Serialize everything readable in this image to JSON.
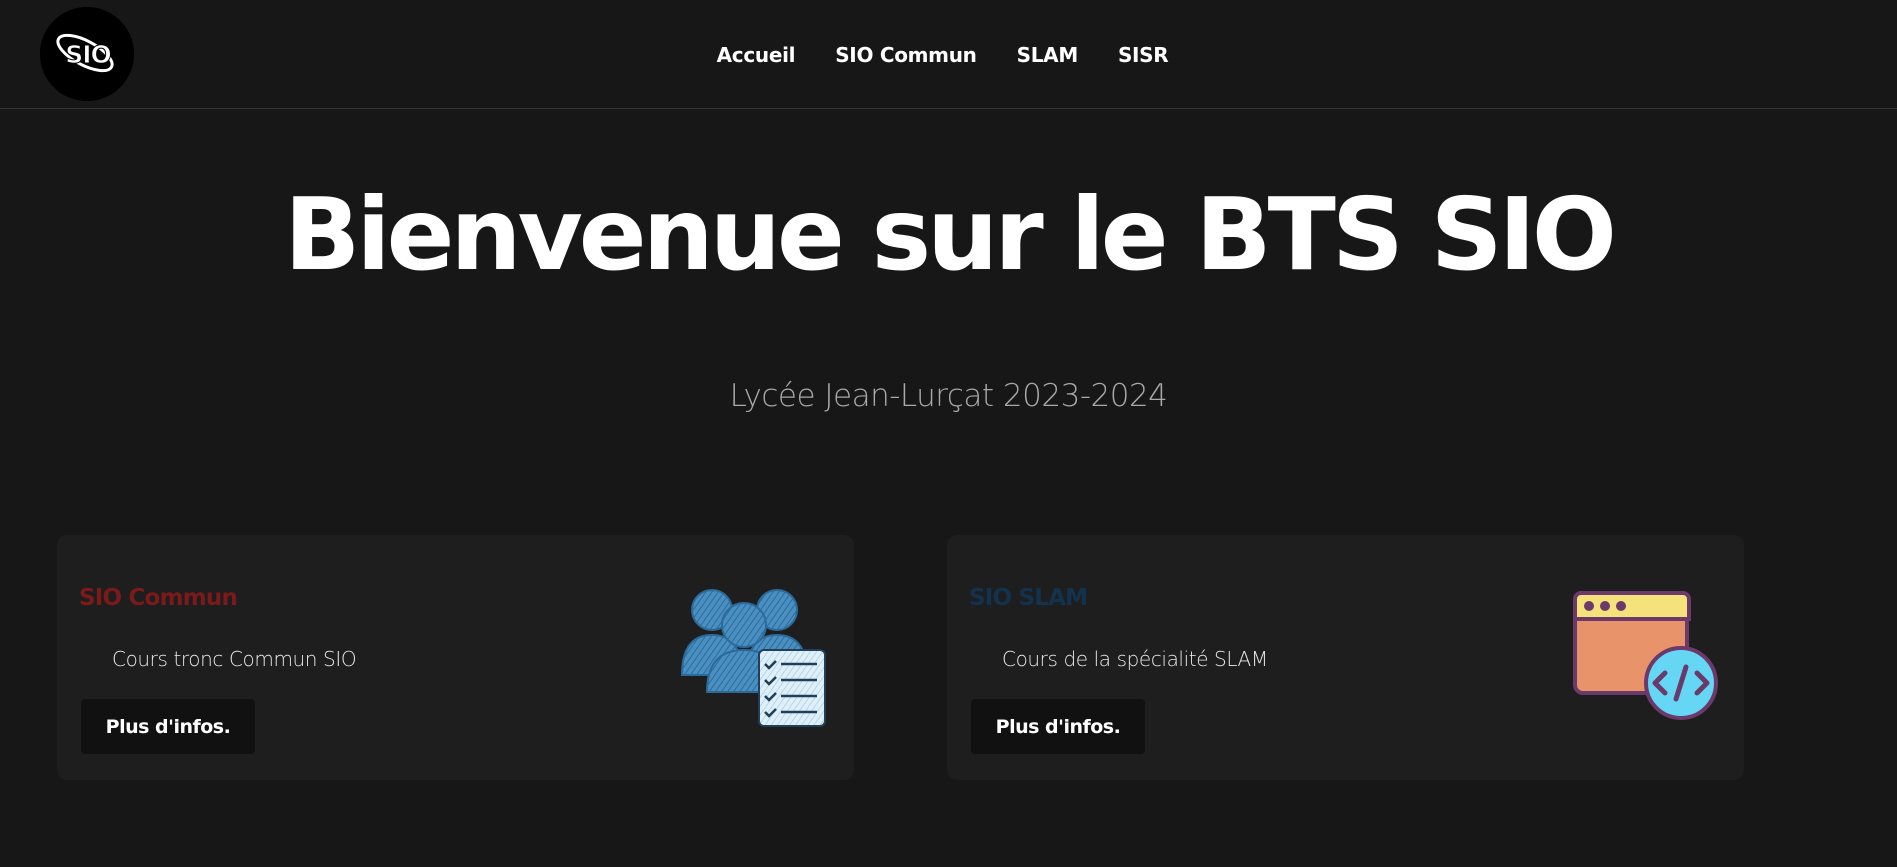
{
  "header": {
    "logo_text": "SIO",
    "nav": [
      {
        "label": "Accueil"
      },
      {
        "label": "SIO Commun"
      },
      {
        "label": "SLAM"
      },
      {
        "label": "SISR"
      }
    ]
  },
  "hero": {
    "title": "Bienvenue sur le BTS SIO",
    "subtitle": "Lycée Jean-Lurçat 2023-2024"
  },
  "cards": [
    {
      "title": "SIO Commun",
      "title_color": "#7a1a1a",
      "description": "Cours tronc Commun SIO",
      "button_label": "Plus d'infos.",
      "icon": "people-checklist-icon"
    },
    {
      "title": "SIO SLAM",
      "title_color": "#13324d",
      "description": "Cours de la spécialité SLAM",
      "button_label": "Plus d'infos.",
      "icon": "browser-code-icon"
    }
  ],
  "colors": {
    "background": "#171717",
    "card_background": "#1e1e1e",
    "button_background": "#111111",
    "subtitle": "#a9a9a9"
  }
}
